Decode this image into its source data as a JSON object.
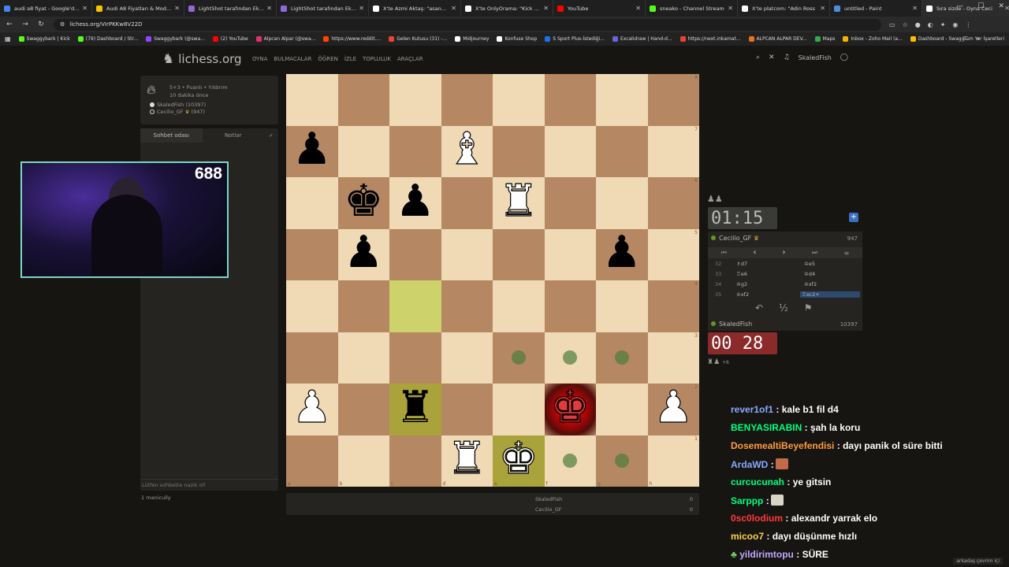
{
  "browser": {
    "tabs": [
      {
        "title": "audi a8 fiyat - Google'da A",
        "icon": "google-icon",
        "color": "#4285f4"
      },
      {
        "title": "Audi A8 Fiyatları & Modelle",
        "icon": "s-icon",
        "color": "#f2c500"
      },
      {
        "title": "LightShot tarafından Ekran",
        "icon": "feather-icon",
        "color": "#8f6ad6"
      },
      {
        "title": "LightShot tarafından Ekran",
        "icon": "feather-icon",
        "color": "#8f6ad6"
      },
      {
        "title": "X'te Azmi Aktaş: \"asansör",
        "icon": "x-icon",
        "color": "#ffffff"
      },
      {
        "title": "X'te OnlyOrama: \"Kick yay",
        "icon": "x-icon",
        "color": "#ffffff"
      },
      {
        "title": "YouTube",
        "icon": "youtube-icon",
        "color": "#ff0000"
      },
      {
        "title": "sneako - Channel Stream",
        "icon": "kick-icon",
        "color": "#53fc18"
      },
      {
        "title": "X'te platcom: \"Adin Ross",
        "icon": "x-icon",
        "color": "#ffffff"
      },
      {
        "title": "untitled - Paint",
        "icon": "paint-icon",
        "color": "#4a90d9"
      },
      {
        "title": "Sıra sizde - Oyna Ceci",
        "icon": "lichess-icon",
        "color": "#ffffff"
      }
    ],
    "new_tab": "+",
    "url": "lichess.org/VIrPKKw8V22D",
    "bookmarks": [
      {
        "label": "Swaggybark | Kick",
        "color": "#53fc18"
      },
      {
        "label": "(79) Dashboard / Str...",
        "color": "#53fc18"
      },
      {
        "label": "Swaggybark (@swa...",
        "color": "#9146ff"
      },
      {
        "label": "(2) YouTube",
        "color": "#ff0000"
      },
      {
        "label": "Alpcan Alpar (@swa...",
        "color": "#e1306c"
      },
      {
        "label": "https://www.reddit....",
        "color": "#ff4500"
      },
      {
        "label": "Gelen Kutusu (31) -...",
        "color": "#ea4335"
      },
      {
        "label": "Midjourney",
        "color": "#ffffff"
      },
      {
        "label": "Konfuse Shop",
        "color": "#ffffff"
      },
      {
        "label": "S Sport Plus-İstediği...",
        "color": "#1a73e8"
      },
      {
        "label": "Excalidraw | Hand-d...",
        "color": "#6965db"
      },
      {
        "label": "https://next.inkamat...",
        "color": "#ea4335"
      },
      {
        "label": "ALPCAN ALPAR DEV...",
        "color": "#e8711a"
      },
      {
        "label": "Maps",
        "color": "#34a853"
      },
      {
        "label": "Inbox - Zoho Mail (a...",
        "color": "#f4b400"
      },
      {
        "label": "Dashboard - Swagg...",
        "color": "#fbbc05"
      }
    ],
    "bookmarks_more": "»",
    "all_bookmarks": "Tüm Yer İşaretleri"
  },
  "lichess": {
    "logo_text": "lichess.org",
    "nav": [
      "OYNA",
      "BULMACALAR",
      "ÖĞREN",
      "İZLE",
      "TOPLULUK",
      "ARAÇLAR"
    ],
    "username": "SkaledFish"
  },
  "game_info": {
    "line1": "5+3 • Puanlı • Yıldırım",
    "line2": "10 dakika önce",
    "white_player": "SkaledFish",
    "white_rating": "(10397)",
    "black_player": "Cecilio_GF",
    "black_rating": "(947)"
  },
  "chat_panel": {
    "tabs": [
      "Sohbet odası",
      "Notlar"
    ],
    "input_placeholder": "Lütfen sohbette nazik ol!",
    "spectators": "1  manicully"
  },
  "webcam": {
    "counter": "688"
  },
  "board": {
    "orientation": "white",
    "ranks": [
      "8",
      "7",
      "6",
      "5",
      "4",
      "3",
      "2",
      "1"
    ],
    "files": [
      "a",
      "b",
      "c",
      "d",
      "e",
      "f",
      "g",
      "h"
    ],
    "pieces": [
      {
        "sq": "a7",
        "piece": "♟",
        "color": "b",
        "name": "black-pawn"
      },
      {
        "sq": "d7",
        "piece": "♝",
        "color": "w",
        "name": "white-bishop"
      },
      {
        "sq": "b6",
        "piece": "♚",
        "color": "b",
        "name": "black-king"
      },
      {
        "sq": "c6",
        "piece": "♟",
        "color": "b",
        "name": "black-pawn"
      },
      {
        "sq": "e6",
        "piece": "♜",
        "color": "w",
        "name": "white-rook"
      },
      {
        "sq": "b5",
        "piece": "♟",
        "color": "b",
        "name": "black-pawn"
      },
      {
        "sq": "g5",
        "piece": "♟",
        "color": "b",
        "name": "black-pawn"
      },
      {
        "sq": "a2",
        "piece": "♟",
        "color": "w",
        "name": "white-pawn"
      },
      {
        "sq": "c2",
        "piece": "♜",
        "color": "b",
        "name": "black-rook"
      },
      {
        "sq": "f2",
        "piece": "♚",
        "color": "w",
        "name": "white-king-in-check"
      },
      {
        "sq": "h2",
        "piece": "♟",
        "color": "w",
        "name": "white-pawn"
      },
      {
        "sq": "d1",
        "piece": "♜",
        "color": "w",
        "name": "white-rook"
      },
      {
        "sq": "e1",
        "piece": "♚",
        "color": "w",
        "name": "white-king-ghost"
      }
    ],
    "highlight": [
      "c4"
    ],
    "last_move_dark": [
      "c2",
      "e1"
    ],
    "check": "f2",
    "destinations": [
      "e3",
      "f3",
      "g3",
      "f1",
      "g1"
    ]
  },
  "under_board": [
    {
      "name": "SkaledFish",
      "score": "0"
    },
    {
      "name": "Cecilio_GF",
      "score": "0"
    }
  ],
  "clocks": {
    "opponent": "01:15",
    "me": "00 28"
  },
  "move_box": {
    "opponent": "Cecilio_GF",
    "opponent_rating": "947",
    "me": "SkaledFish",
    "me_rating": "10397",
    "moves": [
      {
        "n": "32",
        "a": "♗d7",
        "b": "♔e5"
      },
      {
        "n": "33",
        "a": "♖e6",
        "b": "♔d4"
      },
      {
        "n": "34",
        "a": "♔g2",
        "b": "♔xf2"
      },
      {
        "n": "35",
        "a": "♔xf2",
        "b": "♖xc2+"
      }
    ],
    "draw_symbol": "½",
    "material_me": "+6"
  },
  "twitch_chat": [
    {
      "user": "rever1of1",
      "color": "#8aa8ff",
      "msg": ": kale b1 fil d4"
    },
    {
      "user": "BENYASIRABIN",
      "color": "#00ff7f",
      "msg": ": şah la koru"
    },
    {
      "user": "DosemealtiBeyefendisi",
      "color": "#ff9b3d",
      "msg": ": dayı panik ol süre bitti"
    },
    {
      "user": "ArdaWD",
      "color": "#8aa8ff",
      "msg": ":",
      "emote": "#c46a4a"
    },
    {
      "user": "curcucunah",
      "color": "#00ff7f",
      "msg": ": ye gitsin"
    },
    {
      "user": "Sarppp",
      "color": "#00ff7f",
      "msg": ":",
      "emote": "#d8d4c8"
    },
    {
      "user": "0sc0lodium",
      "color": "#ff3a3a",
      "msg": ": alexandr yarrak elo"
    },
    {
      "user": "micoo7",
      "color": "#ffd24a",
      "msg": ": dayı düşünme hızlı"
    },
    {
      "user": "yildirimtopu",
      "color": "#c3a6ff",
      "msg": ": SÜRE"
    }
  ],
  "status_text": "arkadaş çevrim içi"
}
